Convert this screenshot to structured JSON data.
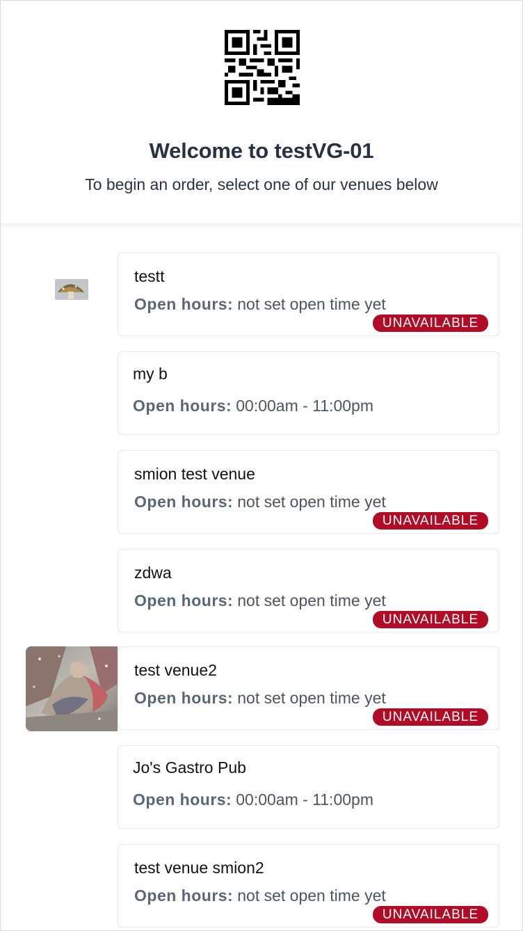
{
  "header": {
    "qr_icon": "qr-code-icon",
    "title": "Welcome to testVG-01",
    "subtitle": "To begin an order, select one of our venues below"
  },
  "venues": [
    {
      "name": "testt",
      "open_hours_label": "Open hours:",
      "open_hours": "not set open time yet",
      "status": "UNAVAILABLE",
      "thumbnail": "mushroom-thumbnail"
    },
    {
      "name": "my b",
      "open_hours_label": "Open hours:",
      "open_hours": "00:00am - 11:00pm"
    },
    {
      "name": "smion test venue",
      "open_hours_label": "Open hours:",
      "open_hours": "not set open time yet",
      "status": "UNAVAILABLE"
    },
    {
      "name": "zdwa",
      "open_hours_label": "Open hours:",
      "open_hours": "not set open time yet",
      "status": "UNAVAILABLE"
    },
    {
      "name": "test venue2",
      "open_hours_label": "Open hours:",
      "open_hours": "not set open time yet",
      "status": "UNAVAILABLE",
      "thumbnail": "fantasy-art-thumbnail"
    },
    {
      "name": "Jo's Gastro Pub",
      "open_hours_label": "Open hours:",
      "open_hours": "00:00am - 11:00pm"
    },
    {
      "name": "test venue smion2",
      "open_hours_label": "Open hours:",
      "open_hours": "not set open time yet",
      "status": "UNAVAILABLE"
    }
  ],
  "colors": {
    "title": "#273244",
    "badge_background": "#b20b25",
    "hours_label": "#5b6677"
  }
}
